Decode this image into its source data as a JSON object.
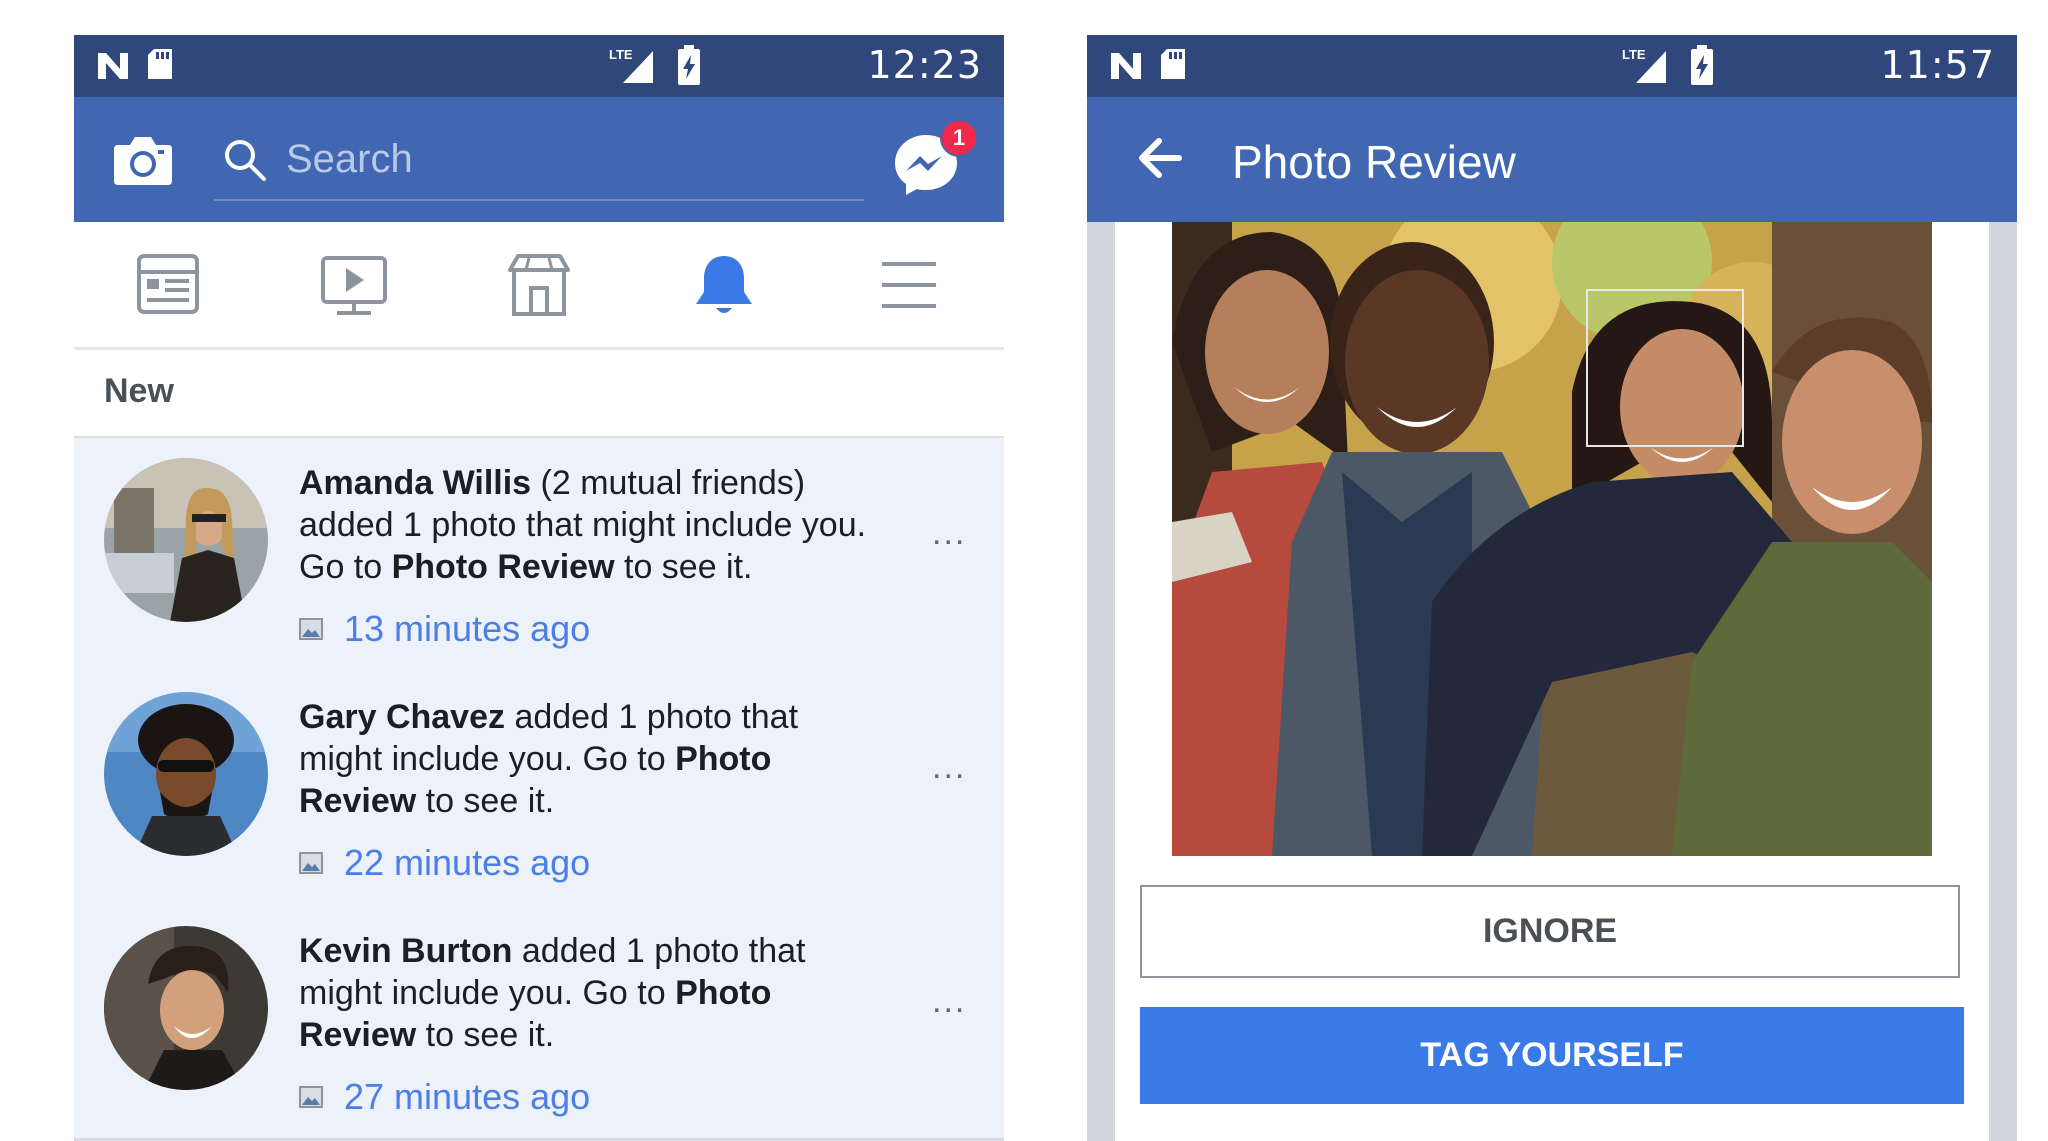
{
  "left_screen": {
    "status_bar": {
      "time": "12:23",
      "network": "LTE"
    },
    "header": {
      "camera_icon": "camera-icon",
      "search_placeholder": "Search",
      "messenger_icon": "messenger-icon",
      "messenger_badge": "1"
    },
    "nav": [
      {
        "name": "news-feed-icon",
        "active": false
      },
      {
        "name": "watch-icon",
        "active": false
      },
      {
        "name": "marketplace-icon",
        "active": false
      },
      {
        "name": "notifications-bell-icon",
        "active": true
      },
      {
        "name": "menu-icon",
        "active": false
      }
    ],
    "section_title": "New",
    "notifications": [
      {
        "name_bold": "Amanda Willis",
        "text_1": " (2 mutual friends) added 1 photo that might include you. Go to ",
        "link_bold": "Photo Review",
        "text_2": " to see it.",
        "time": "13 minutes ago"
      },
      {
        "name_bold": "Gary Chavez",
        "text_1": " added 1 photo that might include you. Go to ",
        "link_bold": "Photo Review",
        "text_2": " to see it.",
        "time": "22 minutes ago"
      },
      {
        "name_bold": "Kevin Burton",
        "text_1": " added 1 photo that might include you. Go to ",
        "link_bold": "Photo Review",
        "text_2": " to see it.",
        "time": "27 minutes ago"
      }
    ],
    "more_label": "..."
  },
  "right_screen": {
    "status_bar": {
      "time": "11:57",
      "network": "LTE"
    },
    "title": "Photo Review",
    "back_icon": "back-arrow-icon",
    "ignore_label": "IGNORE",
    "tag_label": "TAG YOURSELF"
  },
  "colors": {
    "status_bar": "#2f477a",
    "header": "#4167b2",
    "notification_bg": "#edf2fa",
    "link_blue": "#4b7ee6",
    "active_icon": "#3b7ae6",
    "primary_button": "#3a7ae6"
  }
}
